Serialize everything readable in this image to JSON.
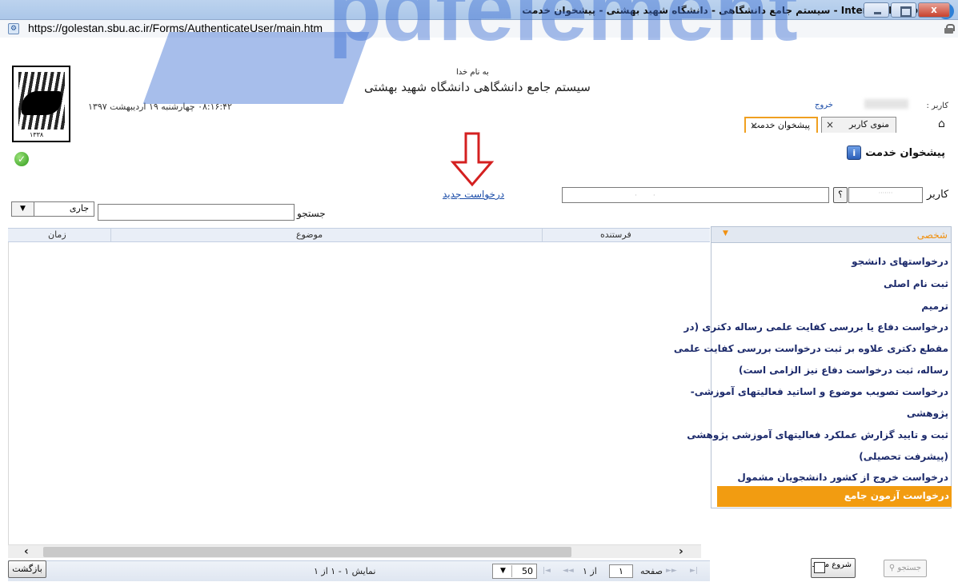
{
  "window": {
    "title": "Internet Explorer - سیستم جامع دانشگاهی - دانشگاه شهید بهشتی - پیشخوان خدمت",
    "close_label": "x",
    "url": "https://golestan.sbu.ac.ir/Forms/AuthenticateUser/main.htm"
  },
  "header": {
    "bismillah": "به نام خدا",
    "system_title": "سیستم جامع دانشگاهی  دانشگاه شهید بهشتی",
    "datetime": "۰۸:۱۶:۴۲ چهارشنبه ۱۹ اردیبهشت ۱۳۹۷",
    "user_label": "کاربر :",
    "logout": "خروج",
    "logo_year": "۱۳۳۸"
  },
  "tabs": [
    {
      "label": "منوی کاربر",
      "close": "×"
    },
    {
      "label": "پیشخوان خدمت",
      "close": "×"
    }
  ],
  "page": {
    "title": "پیشخوان خدمت",
    "info_icon_text": "i"
  },
  "filter": {
    "user_label": "کاربر",
    "help_label": "؟",
    "new_request": "درخواست جدید",
    "search_label": "جستجو",
    "status_value": "جاری"
  },
  "grid": {
    "columns": [
      "فرستنده",
      "موضوع",
      "زمان"
    ],
    "rows": []
  },
  "pager": {
    "page_label": "صفحه",
    "page_value": "۱",
    "of_label": "از ۱",
    "page_size": "50",
    "display_info": "نمایش ۱ - ۱ از ۱"
  },
  "sidebar": {
    "header": "شخصی",
    "items": [
      "درخواستهای دانشجو",
      "ثبت نام اصلی",
      "ترمیم",
      "درخواست دفاع یا بررسی کفایت علمی رساله دکتری  (در",
      "مقطع دکتری علاوه بر ثبت درخواست بررسی کفایت علمی",
      "رساله، ثبت درخواست دفاع نیز الزامی است)",
      "درخواست تصویب موضوع و اساتید فعالیتهای آموزشی-",
      "پژوهشی",
      "ثبت و تایید گزارش عملکرد فعالیتهای آموزشی پژوهشی",
      "(پیشرفت تحصیلی)",
      "درخواست خروج از کشور دانشجویان مشمول",
      "درخواست آزمون جامع"
    ],
    "selected_index": 11
  },
  "footer": {
    "back": "بازگشت",
    "restart": "شروع مجدد",
    "find": "جستجو"
  },
  "watermark": "pdfelement"
}
